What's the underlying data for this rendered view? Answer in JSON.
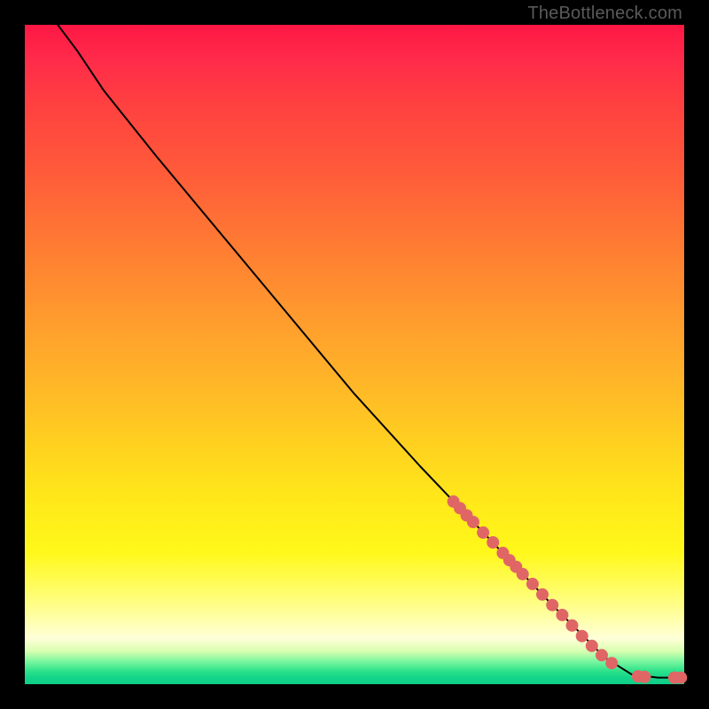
{
  "watermark": "TheBottleneck.com",
  "chart_data": {
    "type": "line",
    "title": "",
    "xlabel": "",
    "ylabel": "",
    "xlim": [
      0,
      100
    ],
    "ylim": [
      0,
      100
    ],
    "curve": [
      {
        "x": 5,
        "y": 100
      },
      {
        "x": 8,
        "y": 96
      },
      {
        "x": 12,
        "y": 90
      },
      {
        "x": 20,
        "y": 80
      },
      {
        "x": 30,
        "y": 68
      },
      {
        "x": 40,
        "y": 56
      },
      {
        "x": 50,
        "y": 44
      },
      {
        "x": 60,
        "y": 33
      },
      {
        "x": 70,
        "y": 22.5
      },
      {
        "x": 80,
        "y": 12
      },
      {
        "x": 88,
        "y": 4
      },
      {
        "x": 92,
        "y": 1.5
      },
      {
        "x": 96,
        "y": 1
      },
      {
        "x": 100,
        "y": 1
      }
    ],
    "markers": [
      {
        "x": 65,
        "y": 27.7
      },
      {
        "x": 66,
        "y": 26.7
      },
      {
        "x": 67,
        "y": 25.6
      },
      {
        "x": 68,
        "y": 24.6
      },
      {
        "x": 69.5,
        "y": 23.0
      },
      {
        "x": 71,
        "y": 21.5
      },
      {
        "x": 72.5,
        "y": 19.9
      },
      {
        "x": 73.5,
        "y": 18.8
      },
      {
        "x": 74.5,
        "y": 17.8
      },
      {
        "x": 75.5,
        "y": 16.7
      },
      {
        "x": 77,
        "y": 15.2
      },
      {
        "x": 78.5,
        "y": 13.6
      },
      {
        "x": 80,
        "y": 12.0
      },
      {
        "x": 81.5,
        "y": 10.5
      },
      {
        "x": 83,
        "y": 8.9
      },
      {
        "x": 84.5,
        "y": 7.3
      },
      {
        "x": 86,
        "y": 5.8
      },
      {
        "x": 87.5,
        "y": 4.4
      },
      {
        "x": 89,
        "y": 3.2
      },
      {
        "x": 93,
        "y": 1.2
      },
      {
        "x": 94,
        "y": 1.1
      },
      {
        "x": 98.5,
        "y": 1.0
      },
      {
        "x": 99.5,
        "y": 1.0
      }
    ],
    "background_gradient": {
      "top": "#ff1744",
      "mid_upper": "#ff9a2e",
      "mid": "#ffe81a",
      "mid_lower": "#ffffd8",
      "bottom": "#0fce86"
    }
  }
}
